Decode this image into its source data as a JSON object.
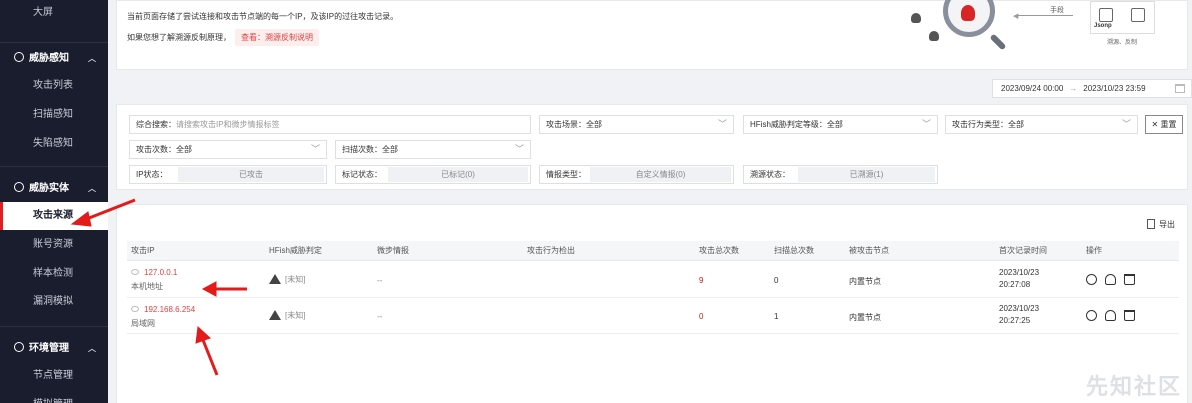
{
  "sidebar": {
    "top_item": "大屏",
    "groups": [
      {
        "label": "威胁感知",
        "items": [
          "攻击列表",
          "扫描感知",
          "失陷感知"
        ]
      },
      {
        "label": "威胁实体",
        "items": [
          "攻击来源",
          "账号资源",
          "样本检测",
          "漏洞模拟"
        ]
      },
      {
        "label": "环境管理",
        "items": [
          "节点管理",
          "模拟管理"
        ]
      }
    ],
    "active_item": "攻击来源"
  },
  "info": {
    "line1": "当前页面存储了尝试连接和攻击节点端的每一个IP，及该IP的过往攻击记录。",
    "line2": "如果您想了解溯源反制原理，",
    "link_prefix": "查看：",
    "link_text": "溯源反制说明"
  },
  "illustration": {
    "means_label": "手段",
    "jsonp_label": "Jsonp",
    "node_caption": "溯源、反制"
  },
  "date_range": {
    "start": "2023/09/24 00:00",
    "arrow": "→",
    "end": "2023/10/23 23:59"
  },
  "filters": {
    "search_label": "综合搜索：",
    "search_placeholder": "请搜索攻击IP和微步情报标签",
    "scene": "攻击场景：全部",
    "hfish_level": "HFish威胁判定等级：全部",
    "behavior": "攻击行为类型：全部",
    "reset": "重置",
    "attack_count": "攻击次数：全部",
    "scan_count": "扫描次数：全部",
    "ip_status_label": "IP状态：",
    "ip_status_value": "已攻击",
    "mark_status_label": "标记状态：",
    "mark_status_value": "已标记(0)",
    "intel_type_label": "情报类型：",
    "intel_type_value": "自定义情报(0)",
    "trace_status_label": "溯源状态：",
    "trace_status_value": "已溯源(1)"
  },
  "table": {
    "export_label": "导出",
    "headers": [
      "攻击IP",
      "HFish威胁判定",
      "微步情报",
      "攻击行为检出",
      "攻击总次数",
      "扫描总次数",
      "被攻击节点",
      "首次记录时间",
      "操作"
    ],
    "rows": [
      {
        "ip": "127.0.0.1",
        "location": "本机地址",
        "verdict": "[未知]",
        "intel": "--",
        "behavior": "",
        "attacks": "9",
        "scans": "0",
        "node": "内置节点",
        "date": "2023/10/23",
        "time": "20:27:08"
      },
      {
        "ip": "192.168.6.254",
        "location": "局域网",
        "verdict": "[未知]",
        "intel": "--",
        "behavior": "",
        "attacks": "0",
        "scans": "1",
        "node": "内置节点",
        "date": "2023/10/23",
        "time": "20:27:25"
      }
    ]
  },
  "watermark": "先知社区",
  "colors": {
    "sidebar_bg": "#1a1d2e",
    "accent_red": "#e02020",
    "ip_red": "#e04040"
  }
}
